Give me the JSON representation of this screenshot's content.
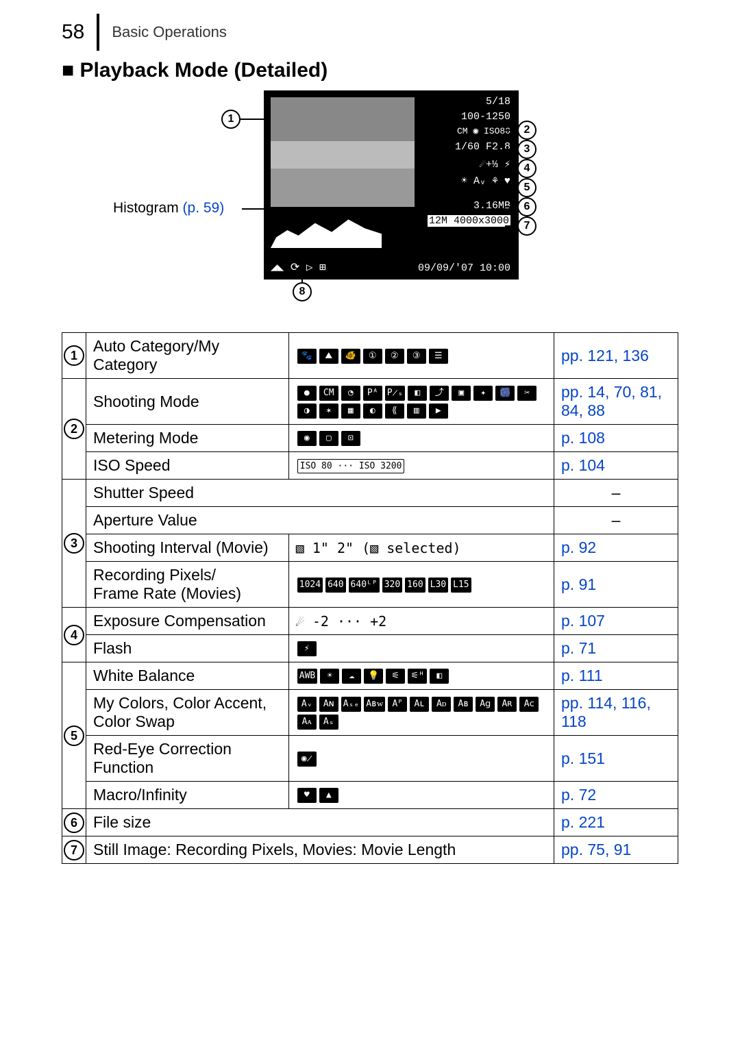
{
  "header": {
    "pagenum": "58",
    "section": "Basic Operations"
  },
  "title": "Playback Mode (Detailed)",
  "diagram": {
    "histogram_label": "Histogram ",
    "histogram_ref": "(p. 59)",
    "screen": {
      "counter": "5/18",
      "filenum": "100-1250",
      "iso_line": "CM ◉ ISO80",
      "exposure": "1/60   F2.8",
      "ev_flash": "☄+⅓  ⚡",
      "icons5": "☀ Aᵥ ⚘   ♥",
      "filesize": "3.16MB",
      "pixels": "12M 4000x3000",
      "bottom_icons": "◢◣ ⟳ ▷ ⊞",
      "datetime": "09/09/'07  10:00"
    },
    "callouts": [
      "1",
      "2",
      "3",
      "4",
      "5",
      "6",
      "7",
      "8"
    ]
  },
  "rows": [
    {
      "num": "1",
      "label": "Auto Category/My Category",
      "icons": [
        "🐾",
        "⛰",
        "🐠",
        "①",
        "②",
        "③",
        "☰"
      ],
      "ref": "pp. 121, 136"
    },
    {
      "num": "2",
      "group": [
        {
          "label": "Shooting Mode",
          "icons": [
            "●",
            "CM",
            "◔",
            "Pᴬ",
            "P̷ₛ",
            "◧",
            "⤴",
            "▣",
            "✦",
            "🎆",
            "✂",
            "◑",
            "✶",
            "▦",
            "◐",
            "⟪",
            "▥",
            "▶"
          ],
          "ref": "pp. 14, 70, 81, 84, 88"
        },
        {
          "label": "Metering Mode",
          "icons": [
            "◉",
            "▢",
            "⊡"
          ],
          "ref": "p. 108"
        },
        {
          "label": "ISO Speed",
          "icons_text": "ISO 80 ··· ISO 3200",
          "ref": "p. 104"
        }
      ]
    },
    {
      "num": "3",
      "group": [
        {
          "label": "Shutter Speed",
          "dash": true
        },
        {
          "label": "Aperture Value",
          "dash": true
        },
        {
          "label": "Shooting Interval (Movie)",
          "icons_text": "▧ 1\" 2\" (▧ selected)",
          "ref": "p. 92"
        },
        {
          "label": "Recording Pixels/\nFrame Rate (Movies)",
          "icons": [
            "1024",
            "640",
            "640ᴸᴾ",
            "320",
            "160",
            "L30",
            "L15"
          ],
          "ref": "p. 91"
        }
      ]
    },
    {
      "num": "4",
      "group": [
        {
          "label": "Exposure Compensation",
          "icons_text": "☄ -2 ··· +2",
          "ref": "p. 107"
        },
        {
          "label": "Flash",
          "icons": [
            "⚡"
          ],
          "ref": "p. 71"
        }
      ]
    },
    {
      "num": "5",
      "group": [
        {
          "label": "White Balance",
          "icons": [
            "AWB",
            "☀",
            "☁",
            "💡",
            "⚟",
            "⚟ᴴ",
            "◧"
          ],
          "ref": "p. 111"
        },
        {
          "label": "My Colors, Color Accent, Color Swap",
          "icons": [
            "Aᵥ",
            "Aɴ",
            "Aₛₑ",
            "Aʙᴡ",
            "Aᴾ",
            "Aʟ",
            "Aᴅ",
            "Aʙ",
            "A𝗀",
            "Aʀ",
            "A𝖼",
            "Aᴀ",
            "Aₛ"
          ],
          "ref": "pp. 114, 116, 118"
        },
        {
          "label": "Red-Eye Correction Function",
          "icons": [
            "◉̷"
          ],
          "ref": "p. 151"
        },
        {
          "label": "Macro/Infinity",
          "icons": [
            "♥",
            "▲"
          ],
          "ref": "p. 72"
        }
      ]
    },
    {
      "num": "6",
      "label": "File size",
      "span": true,
      "ref": "p. 221"
    },
    {
      "num": "7",
      "label": "Still Image: Recording Pixels, Movies: Movie Length",
      "span": true,
      "ref": "pp. 75, 91"
    }
  ]
}
